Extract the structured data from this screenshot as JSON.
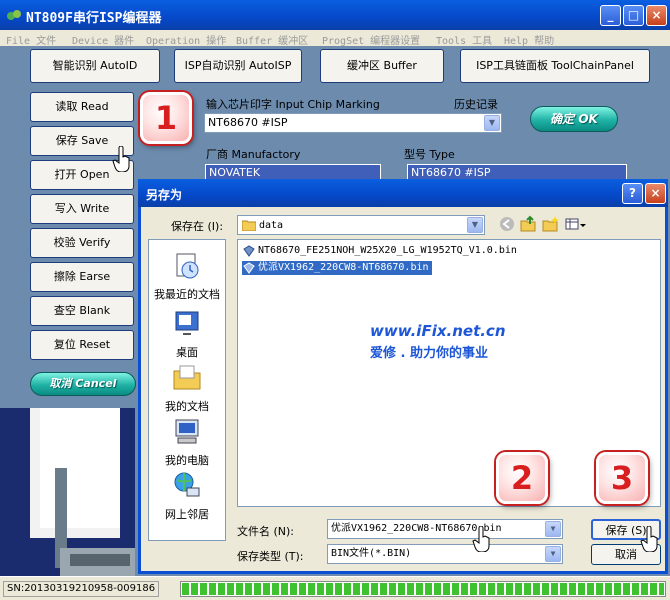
{
  "window": {
    "title": "NT809F串行ISP编程器"
  },
  "menu": [
    "File 文件",
    "Device 器件",
    "Operation 操作",
    "Buffer 缓冲区",
    "ProgSet 编程器设置",
    "Tools 工具",
    "Help 帮助"
  ],
  "toolbar": {
    "auto_id": "智能识别 AutoID",
    "isp_auto": "ISP自动识别 AutoISP",
    "buffer": "缓冲区 Buffer",
    "isp_panel": "ISP工具链面板 ToolChainPanel"
  },
  "side": {
    "read": "读取 Read",
    "save": "保存 Save",
    "open": "打开 Open",
    "write": "写入 Write",
    "verify": "校验 Verify",
    "erase": "擦除 Earse",
    "blank": "查空 Blank",
    "reset": "复位 Reset",
    "cancel": "取消 Cancel"
  },
  "chip": {
    "marking_label": "输入芯片印字 Input Chip Marking",
    "history_label": "历史记录",
    "marking_value": "NT68670 #ISP",
    "ok": "确定 OK",
    "manufactory_label": "厂商 Manufactory",
    "manufactory_value": "NOVATEK",
    "type_label": "型号 Type",
    "type_value": "NT68670 #ISP"
  },
  "dialog": {
    "title": "另存为",
    "save_in_label": "保存在 (I):",
    "save_in_value": "data",
    "places": [
      "我最近的文档",
      "桌面",
      "我的文档",
      "我的电脑",
      "网上邻居"
    ],
    "files": [
      "NT68670_FE251NOH_W25X20_LG_W1952TQ_V1.0.bin",
      "优派VX1962_220CW8-NT68670.bin"
    ],
    "filename_label": "文件名 (N):",
    "filename_value": "优派VX1962_220CW8-NT68670.bin",
    "filetype_label": "保存类型 (T):",
    "filetype_value": "BIN文件(*.BIN)",
    "save_button": "保存 (S)",
    "cancel_button": "取消",
    "help": "?",
    "close": "×"
  },
  "watermark": {
    "line1": "www.iFix.net.cn",
    "line2": "爱修 . 助力你的事业"
  },
  "callouts": [
    "1",
    "2",
    "3"
  ],
  "status": {
    "sn": "SN:20130319210958-009186",
    "progress": 1.0
  },
  "colors": {
    "titlebar": "#0548c8",
    "client": "#6d8bad",
    "ok_glass": "#1fb2a5",
    "callout": "#d81e1e",
    "selection": "#316ac5"
  }
}
